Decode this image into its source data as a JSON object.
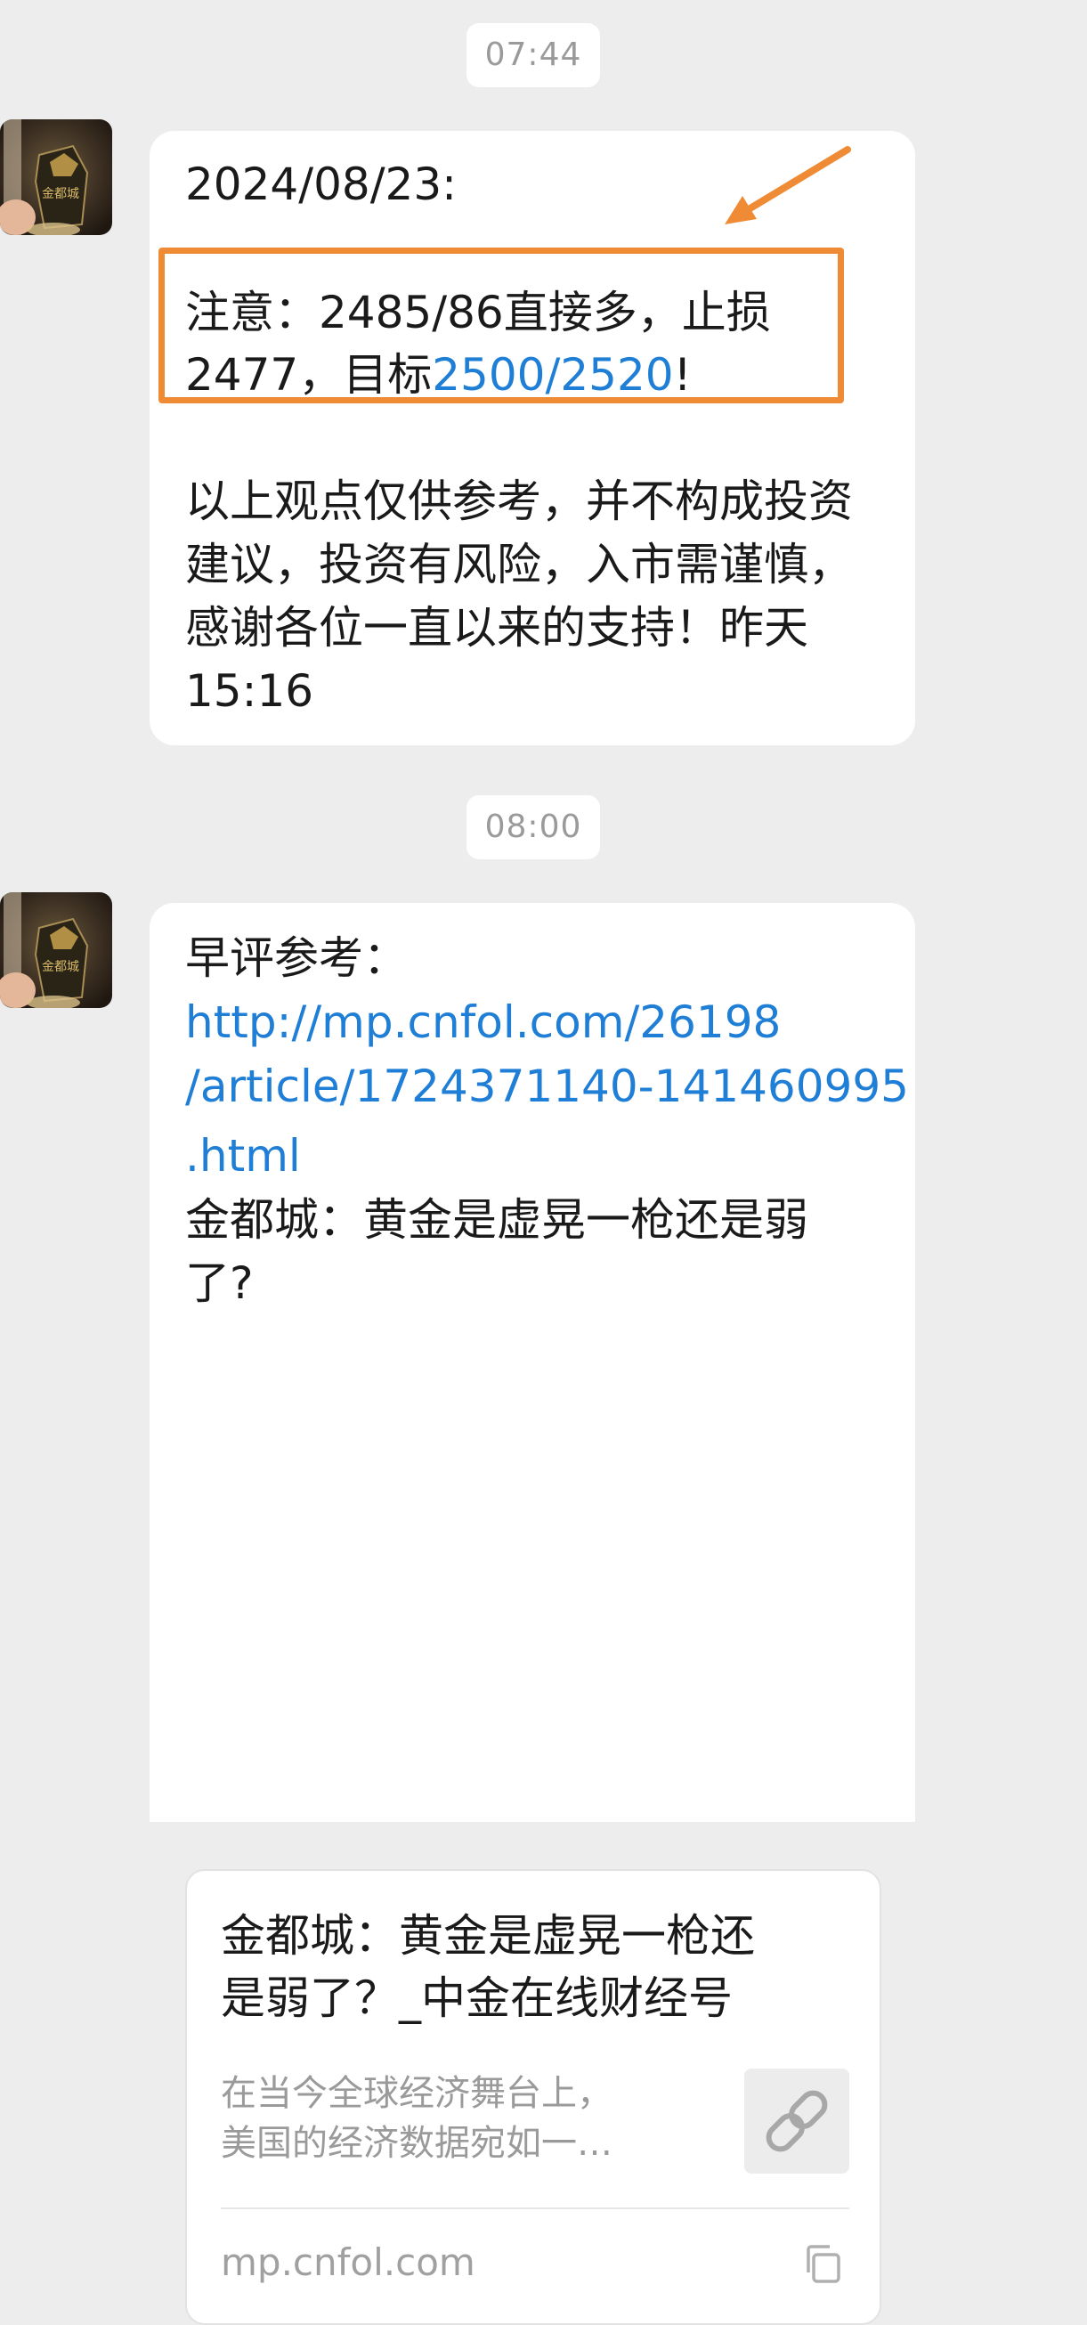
{
  "chat": {
    "messages": [
      {
        "time": "07:44",
        "date_line": "2024/08/23:",
        "notice_line1": "注意：2485/86直接多，止损",
        "notice_line2_prefix": "2477，目标",
        "notice_line2_link": "2500/2520",
        "notice_line2_suffix": "!",
        "disclaimer_line1": "以上观点仅供参考，并不构成投资",
        "disclaimer_line2": "建议，投资有风险，入市需谨慎，",
        "disclaimer_line3": "感谢各位一直以来的支持！昨天",
        "disclaimer_line4": "15:16"
      },
      {
        "time": "08:00",
        "intro": "早评参考：",
        "url_line1": "http://mp.cnfol.com/26198",
        "url_line2": "/article/1724371140-141460995",
        "url_line3": ".html",
        "headline_line1": "金都城：黄金是虚晃一枪还是弱",
        "headline_line2": "了?",
        "card": {
          "title_line1": "金都城：黄金是虚晃一枪还",
          "title_line2": "是弱了？_中金在线财经号",
          "desc_line1": "在当今全球经济舞台上，",
          "desc_line2": "美国的经济数据宛如一…",
          "source": "mp.cnfol.com",
          "thumb_icon": "link-icon",
          "copy_icon": "copy-icon"
        }
      }
    ]
  },
  "colors": {
    "background": "#ededed",
    "bubble": "#ffffff",
    "link": "#1f7ed6",
    "highlight": "#f08b35",
    "muted": "#9a9a9a"
  }
}
